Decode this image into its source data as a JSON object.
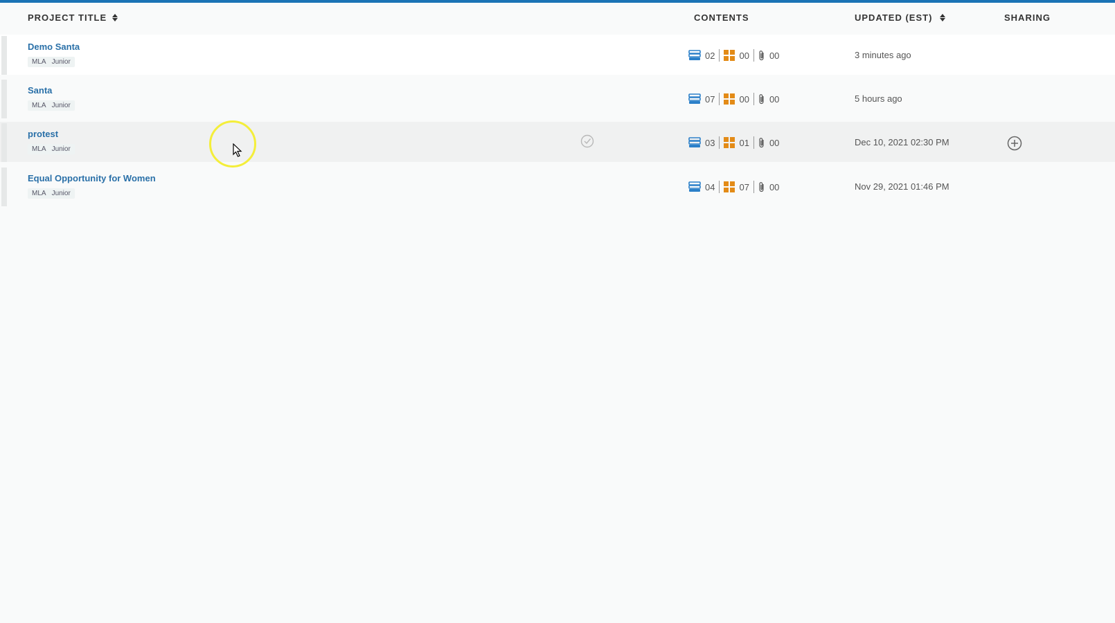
{
  "header": {
    "project_title": "PROJECT TITLE",
    "contents": "CONTENTS",
    "updated": "UPDATED (EST)",
    "sharing": "SHARING"
  },
  "colors": {
    "accent": "#1b73b5",
    "title_link": "#2a70a8",
    "stack_icon": "#2c80c9",
    "grid_icon": "#e38b17"
  },
  "icons": [
    "sort-icon",
    "stack-icon",
    "grid-icon",
    "paperclip-icon",
    "check-circle-icon",
    "add-circle-icon"
  ],
  "projects": [
    {
      "title": "Demo Santa",
      "tags": [
        "MLA",
        "Junior"
      ],
      "sources": "02",
      "notes": "00",
      "attachments": "00",
      "updated": "3 minutes ago"
    },
    {
      "title": "Santa",
      "tags": [
        "MLA",
        "Junior"
      ],
      "sources": "07",
      "notes": "00",
      "attachments": "00",
      "updated": "5 hours ago"
    },
    {
      "title": "protest",
      "tags": [
        "MLA",
        "Junior"
      ],
      "sources": "03",
      "notes": "01",
      "attachments": "00",
      "updated": "Dec 10, 2021 02:30 PM"
    },
    {
      "title": "Equal Opportunity for Women",
      "tags": [
        "MLA",
        "Junior"
      ],
      "sources": "04",
      "notes": "07",
      "attachments": "00",
      "updated": "Nov 29, 2021 01:46 PM"
    }
  ]
}
